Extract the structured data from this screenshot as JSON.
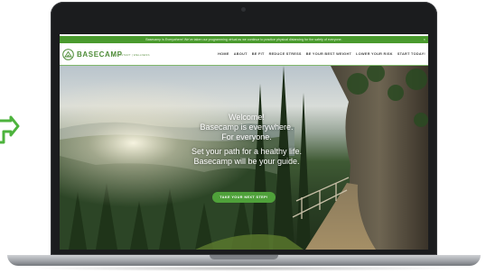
{
  "announcement": {
    "text": "Basecamp is Everywhere! We've taken our programming virtual as we continue to practice physical distancing for the safety of everyone.",
    "close": "×"
  },
  "brand": {
    "name": "BASECAMP",
    "tagline": "FRESHSTART | WELLNESS"
  },
  "nav": [
    "HOME",
    "ABOUT",
    "BE FIT",
    "REDUCE STRESS",
    "BE YOUR BEST WEIGHT",
    "LOWER YOUR RISK",
    "START TODAY!"
  ],
  "hero": {
    "line1": "Welcome!",
    "line2": "Basecamp is everywhere.",
    "line3": "For everyone.",
    "line4": "Set your path for a healthy life.",
    "line5": "Basecamp will be your guide.",
    "cta": "TAKE YOUR NEXT STEP!"
  },
  "colors": {
    "brand_green": "#4f8d39",
    "announce_bg": "#4a9a2e",
    "cta_bg": "#4fa13a",
    "arrow": "#4db33d"
  },
  "icons": {
    "arrow": "green-arrow-icon",
    "logo": "basecamp-logo-icon",
    "close": "close-icon"
  }
}
